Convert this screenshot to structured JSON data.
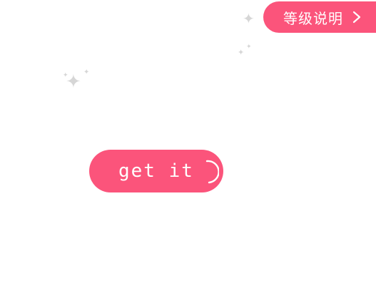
{
  "level_button": {
    "label": "等级说明",
    "icon": "chevron-right-icon"
  },
  "get_button": {
    "label": "get it",
    "icon": "shine-icon"
  },
  "decor": {
    "sparkle_glyph": "✦",
    "sparkle_icon": "sparkle-icon"
  },
  "colors": {
    "accent": "#fb547b",
    "text_on_accent": "#ffffff",
    "sparkle": "#d6d6d6",
    "background": "#ffffff"
  }
}
